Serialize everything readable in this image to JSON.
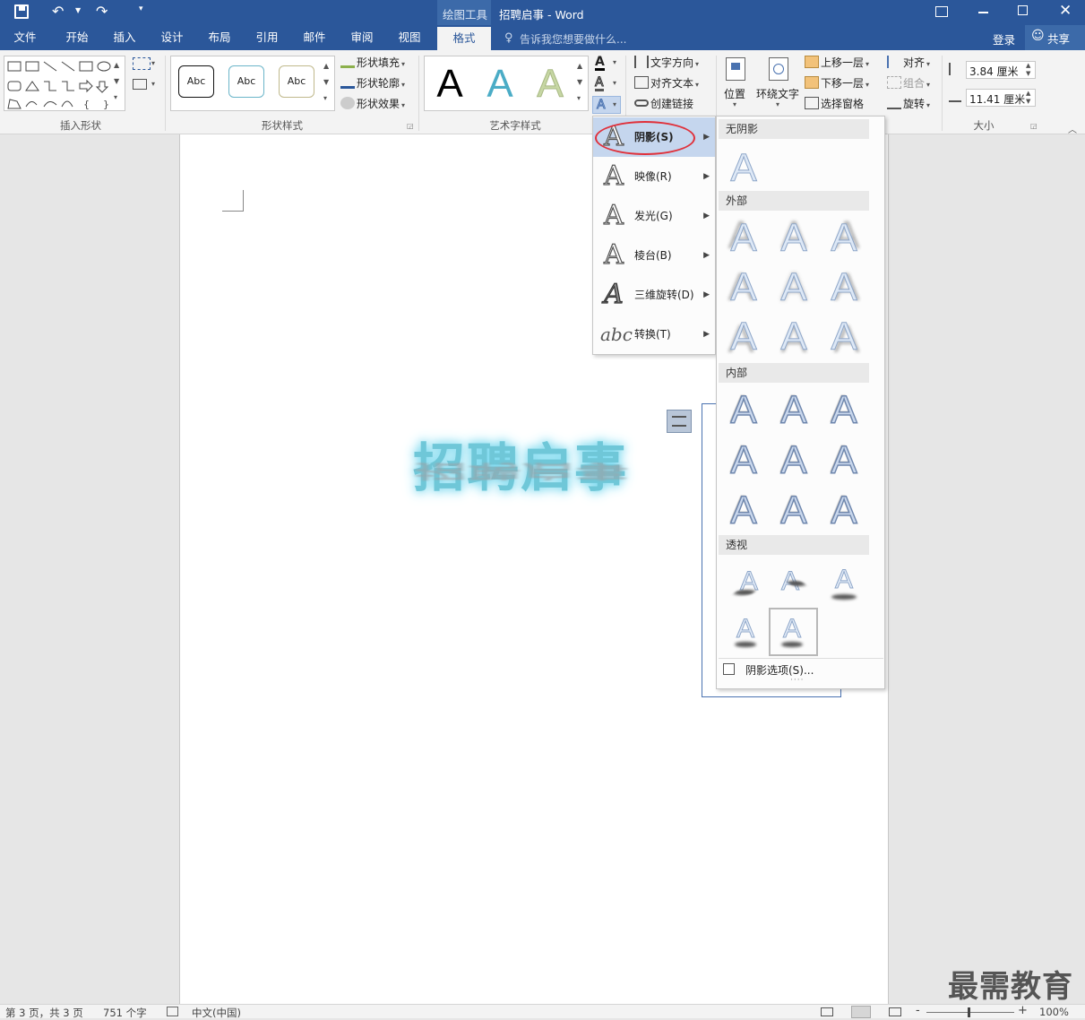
{
  "window": {
    "context_tab_title": "绘图工具",
    "doc_title": "招聘启事 - Word"
  },
  "tabs": [
    "文件",
    "开始",
    "插入",
    "设计",
    "布局",
    "引用",
    "邮件",
    "审阅",
    "视图",
    "格式"
  ],
  "active_tab": "格式",
  "tell_me": "告诉我您想要做什么...",
  "login": "登录",
  "share": "共享",
  "ribbon": {
    "insert_shapes_label": "插入形状",
    "shape_styles_label": "形状样式",
    "shape_style_samples": [
      "Abc",
      "Abc",
      "Abc"
    ],
    "shape_fill": "形状填充",
    "shape_outline": "形状轮廓",
    "shape_effects": "形状效果",
    "wordart_label": "艺术字样式",
    "wordart_sample": "A",
    "text_direction": "文字方向",
    "align_text": "对齐文本",
    "create_link": "创建链接",
    "position": "位置",
    "wrap_text": "环绕文字",
    "bring_forward": "上移一层",
    "send_backward": "下移一层",
    "selection_pane": "选择窗格",
    "align": "对齐",
    "group": "组合",
    "rotate": "旋转",
    "height": "3.84 厘米",
    "width": "11.41 厘米",
    "size_label": "大小"
  },
  "text_effects_menu": {
    "items": [
      {
        "label": "阴影(S)",
        "glyph": "A"
      },
      {
        "label": "映像(R)",
        "glyph": "A"
      },
      {
        "label": "发光(G)",
        "glyph": "A"
      },
      {
        "label": "棱台(B)",
        "glyph": "A"
      },
      {
        "label": "三维旋转(D)",
        "glyph": "A"
      },
      {
        "label": "转换(T)",
        "glyph": "abc"
      }
    ]
  },
  "shadow_gallery": {
    "no_shadow": "无阴影",
    "outer": "外部",
    "inner": "内部",
    "perspective": "透视",
    "sample_letter": "A",
    "options": "阴影选项(S)..."
  },
  "document": {
    "wordart_text": "招聘启事"
  },
  "status": {
    "page": "第 3 页，共 3 页",
    "words": "751 个字",
    "language": "中文(中国)",
    "zoom": "100%"
  },
  "watermark": "最需教育"
}
